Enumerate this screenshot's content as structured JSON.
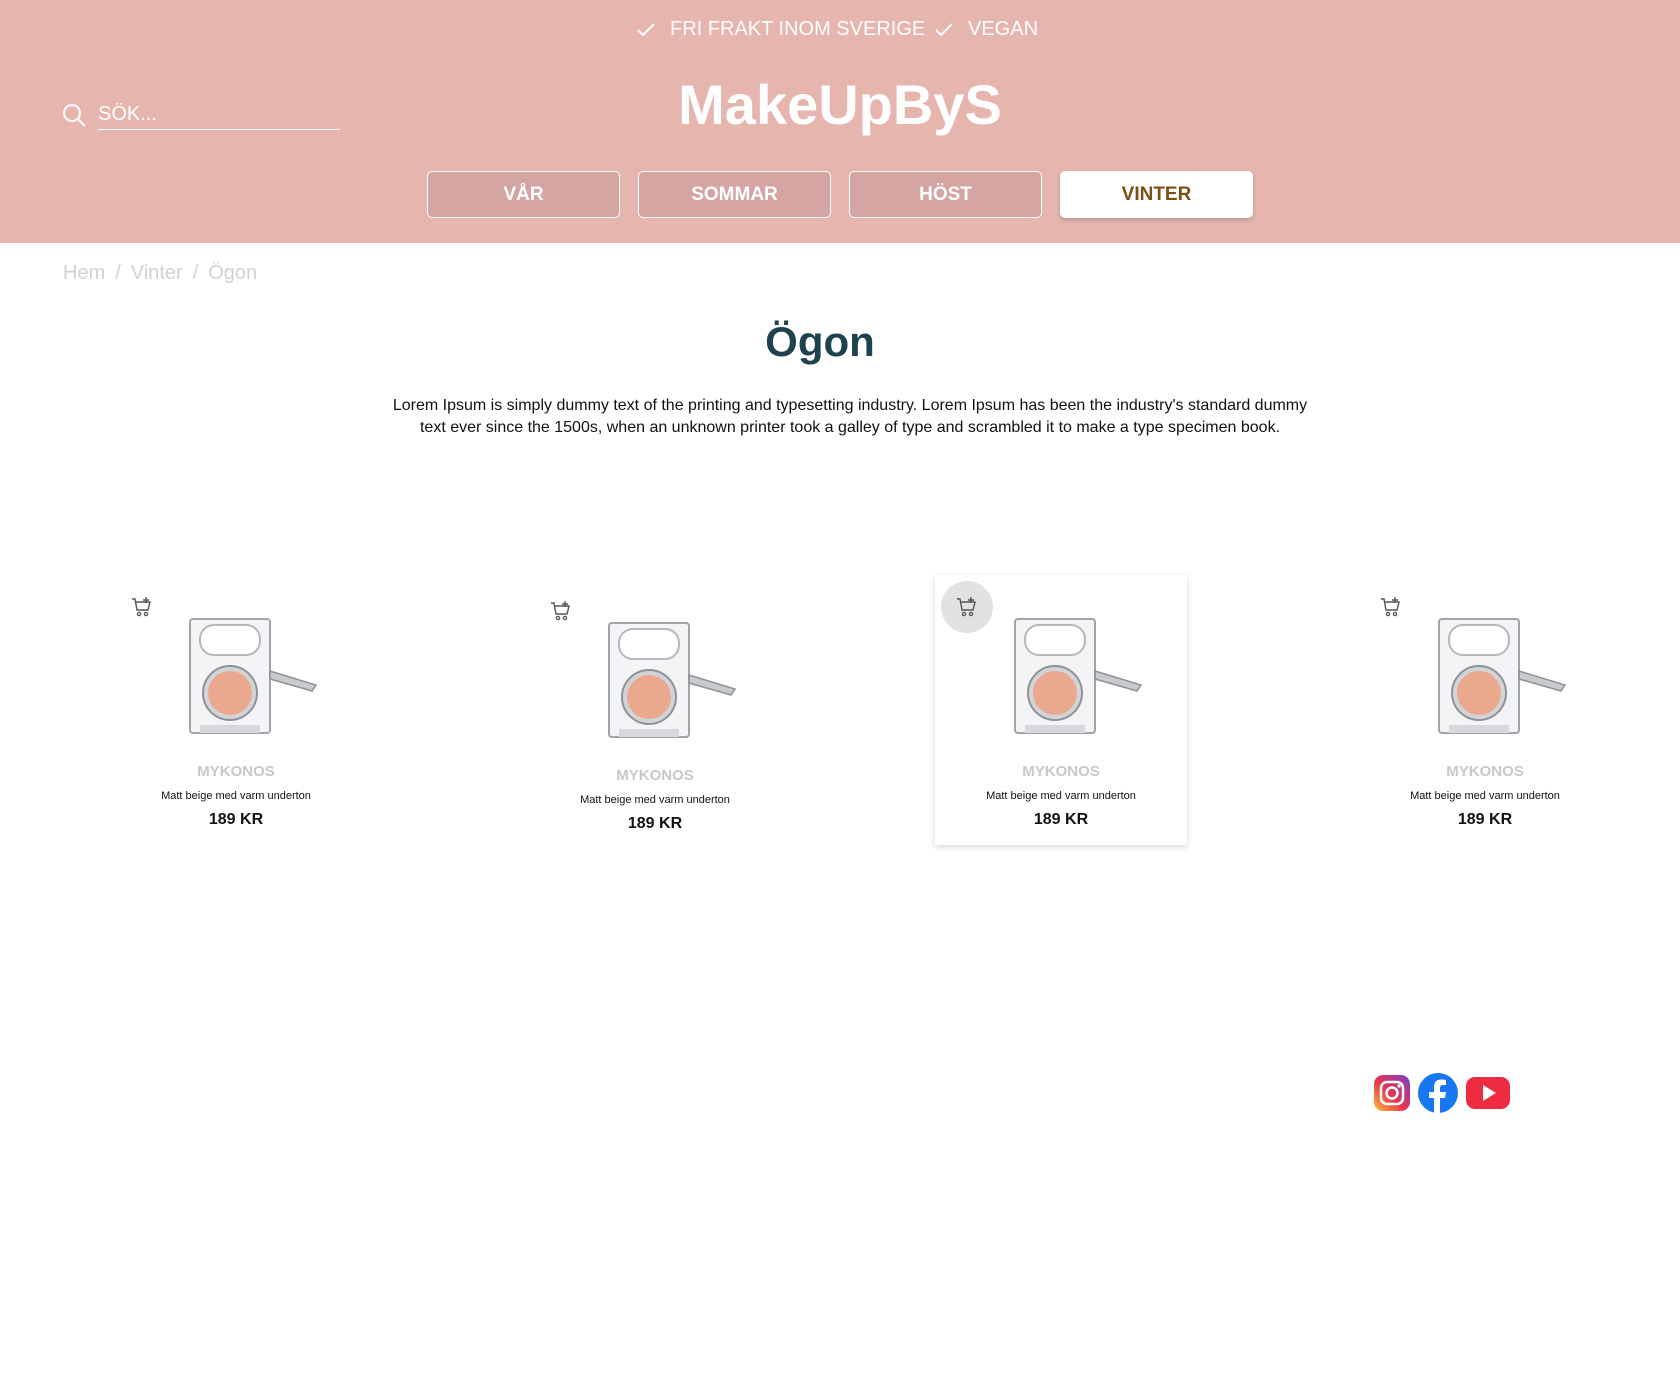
{
  "header": {
    "perks": [
      "FRI FRAKT INOM SVERIGE",
      "VEGAN"
    ],
    "brand": "MakeUpByS",
    "search": {
      "placeholder": "SÖK..."
    },
    "seasons": [
      {
        "label": "VÅR",
        "active": false
      },
      {
        "label": "SOMMAR",
        "active": false
      },
      {
        "label": "HÖST",
        "active": false
      },
      {
        "label": "VINTER",
        "active": true
      }
    ]
  },
  "breadcrumb": [
    "Hem",
    "/",
    "Vinter",
    "/",
    "Ögon"
  ],
  "page": {
    "title": "Ögon",
    "intro": "Lorem Ipsum is simply dummy text of the printing and typesetting industry. Lorem Ipsum has been the industry's standard dummy text ever since the 1500s, when an unknown printer took a galley of type and scrambled it to make a type specimen book."
  },
  "products": [
    {
      "name": "MYKONOS",
      "desc": "Matt beige med varm underton",
      "price": "189 KR",
      "icon": "cart-add-icon"
    },
    {
      "name": "MYKONOS",
      "desc": "Matt beige med varm underton",
      "price": "189 KR",
      "icon": "cart-add-icon"
    },
    {
      "name": "MYKONOS",
      "desc": "Matt beige med varm underton",
      "price": "189 KR",
      "icon": "cart-add-icon"
    },
    {
      "name": "MYKONOS",
      "desc": "Matt beige med varm underton",
      "price": "189 KR",
      "icon": "cart-add-icon"
    }
  ],
  "social": [
    "instagram-icon",
    "facebook-icon",
    "youtube-icon"
  ],
  "colors": {
    "header_bg": "#e5b5ae",
    "season_bg": "#d4a5a2",
    "active_text": "#7a4f14",
    "title": "#1f4250"
  }
}
